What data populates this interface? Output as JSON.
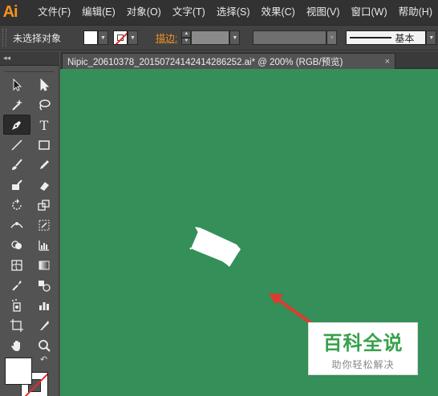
{
  "app": {
    "logo": "Ai",
    "accent": "#f7931e"
  },
  "menu": [
    "文件(F)",
    "编辑(E)",
    "对象(O)",
    "文字(T)",
    "选择(S)",
    "效果(C)",
    "视图(V)",
    "窗口(W)",
    "帮助(H)"
  ],
  "control": {
    "selection_label": "未选择对象",
    "stroke_label": "描边:",
    "brush_label": "基本"
  },
  "toolbar": {
    "collapse_glyph": "◂◂",
    "swap_glyph": "↶"
  },
  "document": {
    "tab_title": "Nipic_20610378_20150724142414286252.ai* @ 200% (RGB/预览)",
    "close_glyph": "×",
    "canvas_color": "#348f58"
  },
  "watermark": {
    "title": "百科全说",
    "subtitle": "助你轻松解决",
    "color": "#37a14b"
  }
}
